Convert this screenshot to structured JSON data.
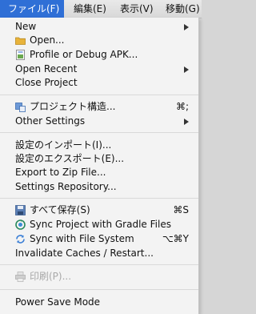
{
  "menubar": {
    "file": "ファイル(F)",
    "edit": "編集(E)",
    "view": "表示(V)",
    "move": "移動(G)"
  },
  "menu": {
    "new": "New",
    "open": "Open...",
    "profile_debug": "Profile or Debug APK...",
    "open_recent": "Open Recent",
    "close_project": "Close Project",
    "project_structure": "プロジェクト構造...",
    "project_structure_shortcut": "⌘;",
    "other_settings": "Other Settings",
    "import_settings": "設定のインポート(I)...",
    "export_settings": "設定のエクスポート(E)...",
    "export_zip": "Export to Zip File...",
    "settings_repo": "Settings Repository...",
    "save_all": "すべて保存(S)",
    "save_all_shortcut": "⌘S",
    "sync_gradle": "Sync Project with Gradle Files",
    "sync_fs": "Sync with File System",
    "sync_fs_shortcut": "⌥⌘Y",
    "invalidate": "Invalidate Caches / Restart...",
    "print": "印刷(P)...",
    "power_save": "Power Save Mode"
  },
  "colors": {
    "accent": "#2f6fd6",
    "disabled_text": "#a8a8a8"
  }
}
